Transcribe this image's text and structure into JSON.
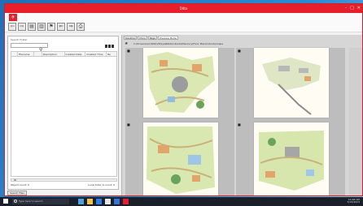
{
  "window": {
    "title": "Ditto",
    "ctrls": [
      "–",
      "□",
      "✕"
    ]
  },
  "toolbar": {
    "buttons": [
      "⇦",
      "⇨",
      "▤",
      "▥",
      "⚑",
      "⇐",
      "⇒",
      "⎙"
    ]
  },
  "left_panel": {
    "label": "Search Folder",
    "search_value": "",
    "columns": [
      "",
      "Filename",
      "",
      "Description",
      "Created Date",
      "Created Time",
      "Re"
    ],
    "status_left": "Object count: 0",
    "status_right": "Local total: 0  count: 0"
  },
  "bottom_button": "Search Files",
  "right_panel": {
    "tabs": [
      "Desktop",
      "Docs",
      "Page",
      "Preview Mode"
    ],
    "path": "C:\\Drivers\\rec\\S09\\V4\\Sys\\Beta\\Cutouts\\Mercury\\Floor Plan\\Cutouts\\maps"
  },
  "taskbar": {
    "search_placeholder": "Type here to search",
    "time": "10:48 AM",
    "date": "5/15/2023"
  }
}
